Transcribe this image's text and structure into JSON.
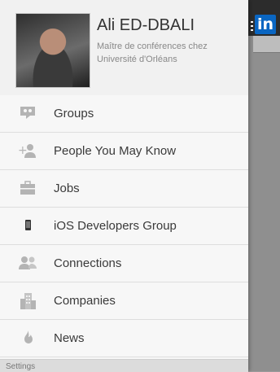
{
  "profile": {
    "name": "Ali ED-DBALI",
    "headline": "Maître de conférences chez Université d'Orléans"
  },
  "brand": {
    "logo_text": "in",
    "color": "#0a66c2"
  },
  "menu": [
    {
      "label": "Groups",
      "icon": "groups-icon"
    },
    {
      "label": "People You May Know",
      "icon": "add-person-icon"
    },
    {
      "label": "Jobs",
      "icon": "briefcase-icon"
    },
    {
      "label": "iOS Developers Group",
      "icon": "phone-icon"
    },
    {
      "label": "Connections",
      "icon": "connections-icon"
    },
    {
      "label": "Companies",
      "icon": "building-icon"
    },
    {
      "label": "News",
      "icon": "flame-icon"
    }
  ],
  "settings": {
    "label": "Settings"
  }
}
